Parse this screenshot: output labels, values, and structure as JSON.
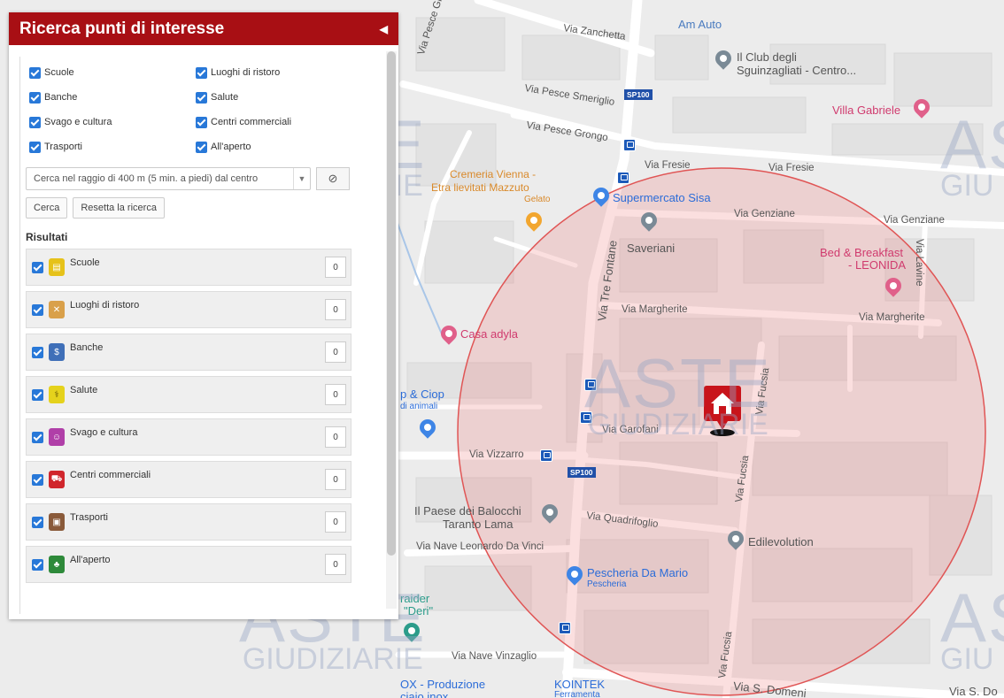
{
  "panel": {
    "title": "Ricerca punti di interesse",
    "collapse_icon": "triangle-left-icon",
    "categories": [
      {
        "label": "Scuole",
        "checked": true
      },
      {
        "label": "Luoghi di ristoro",
        "checked": true
      },
      {
        "label": "Banche",
        "checked": true
      },
      {
        "label": "Salute",
        "checked": true
      },
      {
        "label": "Svago e cultura",
        "checked": true
      },
      {
        "label": "Centri commerciali",
        "checked": true
      },
      {
        "label": "Trasporti",
        "checked": true
      },
      {
        "label": "All'aperto",
        "checked": true
      }
    ],
    "radius_select": "Cerca nel raggio di 400 m (5 min. a piedi) dal centro",
    "search_button": "Cerca",
    "reset_button": "Resetta la ricerca",
    "results_title": "Risultati",
    "results": [
      {
        "label": "Scuole",
        "count": "0",
        "color": "#e6c21a",
        "icon": "school-icon"
      },
      {
        "label": "Luoghi di ristoro",
        "count": "0",
        "color": "#d9a04a",
        "icon": "utensils-icon"
      },
      {
        "label": "Banche",
        "count": "0",
        "color": "#3f6fb8",
        "icon": "bank-icon"
      },
      {
        "label": "Salute",
        "count": "0",
        "color": "#e5d21c",
        "icon": "health-icon"
      },
      {
        "label": "Svago e cultura",
        "count": "0",
        "color": "#b03fa8",
        "icon": "theater-icon"
      },
      {
        "label": "Centri commerciali",
        "count": "0",
        "color": "#d0262c",
        "icon": "cart-icon"
      },
      {
        "label": "Trasporti",
        "count": "0",
        "color": "#8a5a3a",
        "icon": "bus-icon"
      },
      {
        "label": "All'aperto",
        "count": "0",
        "color": "#2e8a3a",
        "icon": "tree-icon"
      }
    ]
  },
  "map": {
    "roads": {
      "zanchetta": "Via Zanchetta",
      "pesce_grongo_v": "Via Pesce Grongo",
      "pesce_smeriglio": "Via Pesce Smeriglio",
      "pesce_grongo": "Via Pesce Grongo",
      "fresie_1": "Via Fresie",
      "fresie_2": "Via Fresie",
      "genziane_1": "Via Genziane",
      "genziane_2": "Via Genziane",
      "lavine": "Via Lavine",
      "tre_fontane": "Via Tre Fontane",
      "margherite_1": "Via Margherite",
      "margherite_2": "Via Margherite",
      "fucsia_1": "Via Fucsia",
      "garofani": "Via Garofani",
      "vizzarro": "Via Vizzarro",
      "fucsia_2": "Via Fucsia",
      "quadrifoglio": "Via Quadrifoglio",
      "nave_leonardo": "Via Nave Leonardo Da Vinci",
      "fucsia_3": "Via Fucsia",
      "nave_vinzaglio": "Via Nave Vinzaglio",
      "s_domenico_1": "Via S. Domeni",
      "s_domenico_2": "Via S. Do",
      "sp100_a": "SP100",
      "sp100_b": "SP100"
    },
    "pois": {
      "am_auto": "Am Auto",
      "club_1": "Il Club degli",
      "club_2": "Sguinzagliati - Centro...",
      "villa_gabriele": "Villa Gabriele",
      "cremeria_1": "Cremeria Vienna -",
      "cremeria_2": "Etra lievitati Mazzuto",
      "gelato": "Gelato",
      "sisa": "Supermercato Sisa",
      "saveriani": "Saveriani",
      "bnb_1": "Bed & Breakfast",
      "bnb_2": "- LEONIDA",
      "casa_adyla": "Casa adyla",
      "ciop_1": "p & Ciop",
      "ciop_2": "di animali",
      "balocchi_1": "Il Paese dei Balocchi",
      "balocchi_2": "Taranto Lama",
      "edilevolution": "Edilevolution",
      "pescheria": "Pescheria Da Mario",
      "pescheria_sub": "Pescheria",
      "raider_1": "raider",
      "raider_2": "\"Deri\"",
      "produzione_1": "OX - Produzione",
      "produzione_2": "ciaio inox",
      "kointek": "KOINTEK",
      "ferramenta": "Ferramenta"
    },
    "watermark": {
      "line1": "ASTE",
      "line2": "GIUDIZIARIE"
    }
  }
}
